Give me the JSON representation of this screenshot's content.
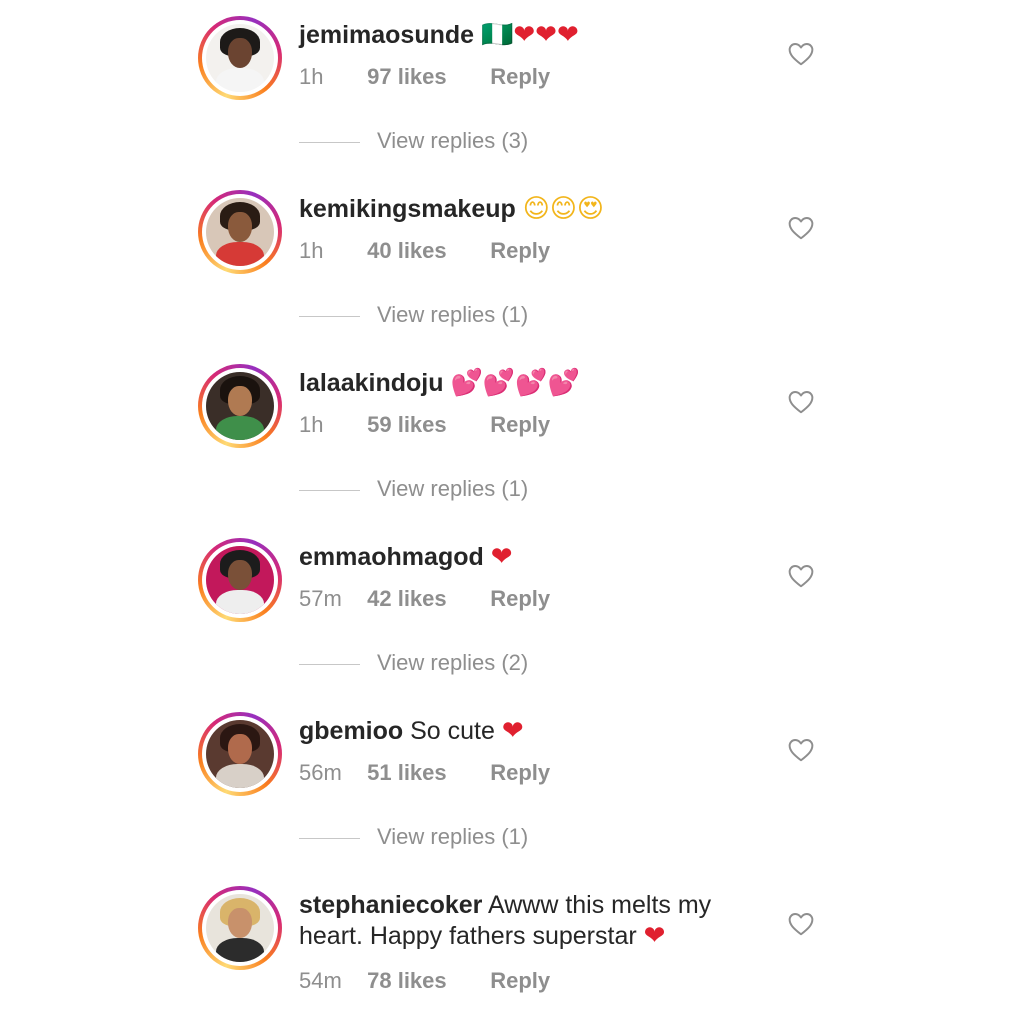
{
  "comments": [
    {
      "username": "jemimaosunde",
      "text": "",
      "emoji": "🇳🇬❤❤❤",
      "time": "1h",
      "likes": "97 likes",
      "reply": "Reply",
      "view_replies": "View replies (3)",
      "avatar_colors": {
        "bg": "#f3f1ee",
        "hair": "#1d1a18",
        "skin": "#6b4431",
        "body": "#f5f5f5"
      }
    },
    {
      "username": "kemikingsmakeup",
      "text": "",
      "emoji": "😊😊😍",
      "time": "1h",
      "likes": "40 likes",
      "reply": "Reply",
      "view_replies": "View replies (1)",
      "avatar_colors": {
        "bg": "#d8c7b8",
        "hair": "#2a1c14",
        "skin": "#8a5a3c",
        "body": "#d63a36"
      }
    },
    {
      "username": "lalaakindoju",
      "text": "",
      "emoji": "💕💕💕💕",
      "time": "1h",
      "likes": "59 likes",
      "reply": "Reply",
      "view_replies": "View replies (1)",
      "avatar_colors": {
        "bg": "#3a2e28",
        "hair": "#1a120e",
        "skin": "#b07a52",
        "body": "#3f8f4a"
      }
    },
    {
      "username": "emmaohmagod",
      "text": "",
      "emoji": "❤",
      "time": "57m",
      "likes": "42 likes",
      "reply": "Reply",
      "view_replies": "View replies (2)",
      "avatar_colors": {
        "bg": "#c2185b",
        "hair": "#1c1c1c",
        "skin": "#7a5038",
        "body": "#eeeeee"
      }
    },
    {
      "username": "gbemioo",
      "text": "So cute",
      "emoji": "❤",
      "time": "56m",
      "likes": "51 likes",
      "reply": "Reply",
      "view_replies": "View replies (1)",
      "avatar_colors": {
        "bg": "#5a3a30",
        "hair": "#2b1712",
        "skin": "#b06a4c",
        "body": "#d8d0c8"
      }
    },
    {
      "username": "stephaniecoker",
      "text": "Awww this melts my heart. Happy fathers superstar",
      "emoji": "❤",
      "time": "54m",
      "likes": "78 likes",
      "reply": "Reply",
      "view_replies": "",
      "avatar_colors": {
        "bg": "#e8e4dc",
        "hair": "#d9b46a",
        "skin": "#c8916b",
        "body": "#2c2c2c"
      }
    }
  ],
  "icons": {
    "like": "heart-outline-icon"
  },
  "colors": {
    "text": "#262626",
    "muted": "#8e8e8e",
    "heart": "#e0202f",
    "divider": "#c7c7c7"
  }
}
